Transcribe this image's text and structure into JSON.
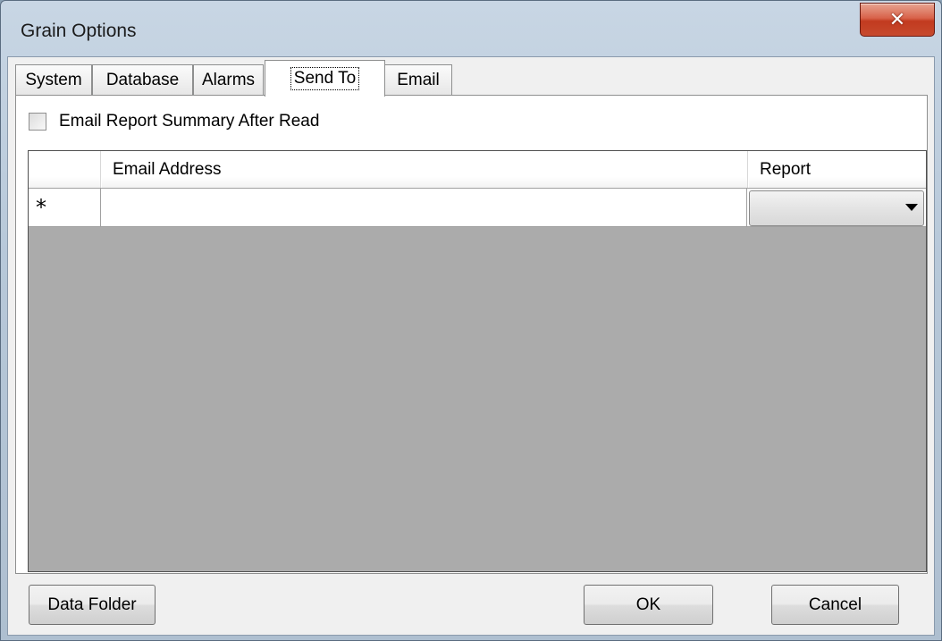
{
  "window": {
    "title": "Grain Options",
    "close_label": "x"
  },
  "tabs": [
    {
      "label": "System",
      "active": false
    },
    {
      "label": "Database",
      "active": false
    },
    {
      "label": "Alarms",
      "active": false
    },
    {
      "label": "Send To",
      "active": true
    },
    {
      "label": "Email",
      "active": false
    }
  ],
  "send_to": {
    "checkbox_label": "Email Report Summary After Read",
    "checkbox_checked": false,
    "grid": {
      "columns": [
        "",
        "Email Address",
        "Report"
      ],
      "new_row_marker": "*",
      "rows": [
        {
          "email": "",
          "report": ""
        }
      ]
    }
  },
  "buttons": {
    "data_folder": "Data Folder",
    "ok": "OK",
    "cancel": "Cancel"
  },
  "colors": {
    "grid_background": "#ababab",
    "close_button": "#c74a2e"
  }
}
